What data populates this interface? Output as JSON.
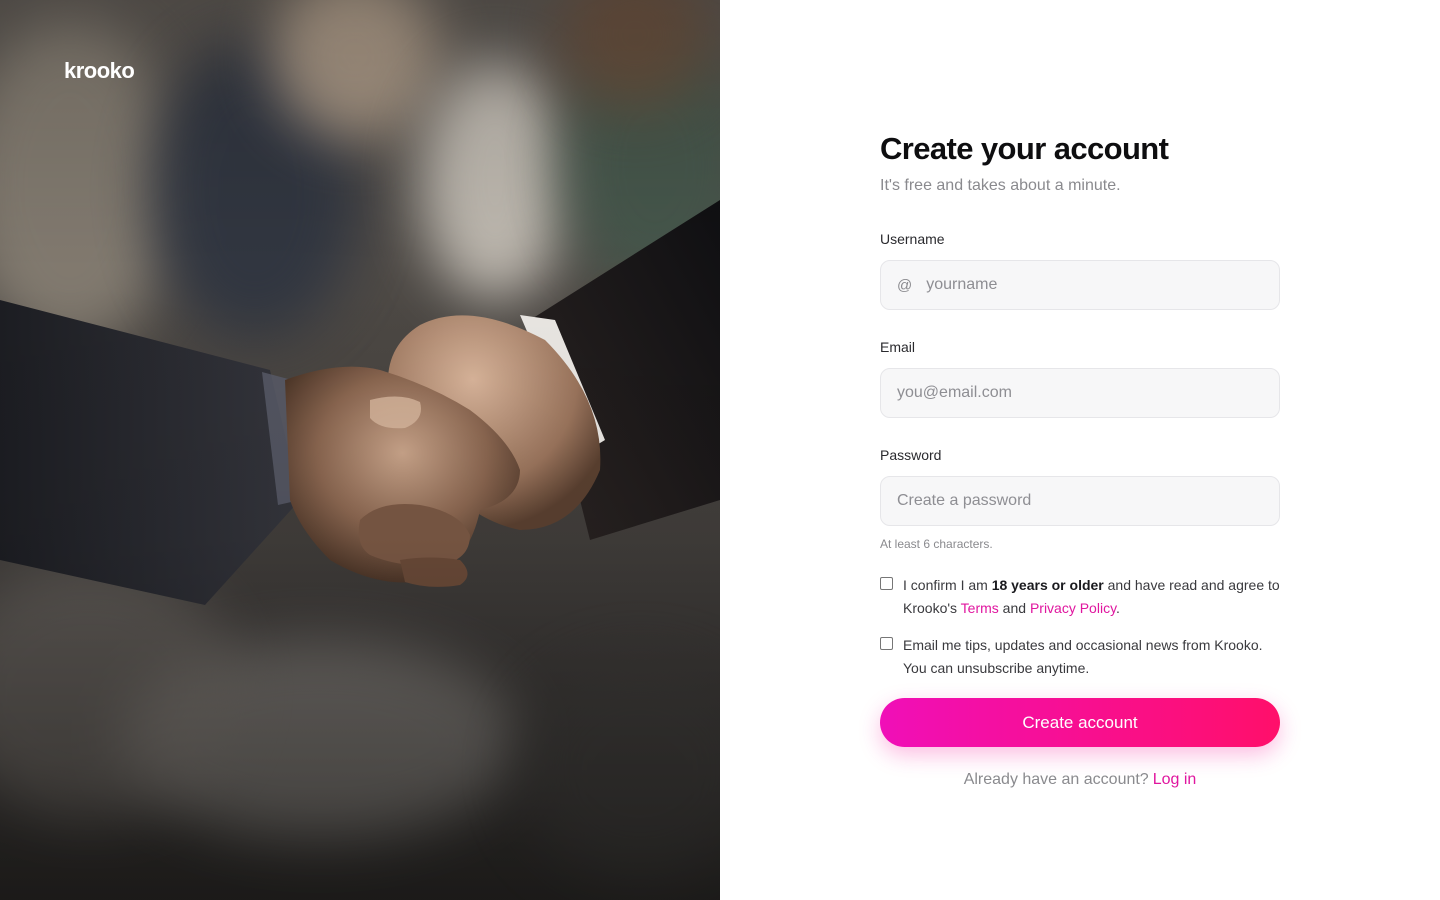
{
  "brand": {
    "logo_text": "krooko",
    "accent": "#e0169f",
    "cta_gradient": [
      "#f00fb8",
      "#ff0f6a"
    ]
  },
  "hero": {
    "image": "handshake-photo"
  },
  "form": {
    "title": "Create your account",
    "subtitle": "It's free and takes about a minute.",
    "username": {
      "label": "Username",
      "prefix": "@",
      "placeholder": "yourname",
      "value": ""
    },
    "email": {
      "label": "Email",
      "placeholder": "you@email.com",
      "value": ""
    },
    "password": {
      "label": "Password",
      "placeholder": "Create a password",
      "value": "",
      "hint": "At least 6 characters."
    },
    "age_consent": {
      "checked": false,
      "text_before": "I confirm I am ",
      "emphasis": "18 years or older",
      "text_middle": " and have read and agree to Krooko's ",
      "terms_link": "Terms",
      "and": " and ",
      "privacy_link": "Privacy Policy",
      "period": "."
    },
    "marketing_optin": {
      "checked": false,
      "text": "Email me tips, updates and occasional news from Krooko. You can unsubscribe anytime."
    },
    "submit_label": "Create account",
    "login_prompt": "Already have an account?",
    "login_link": "Log in"
  }
}
